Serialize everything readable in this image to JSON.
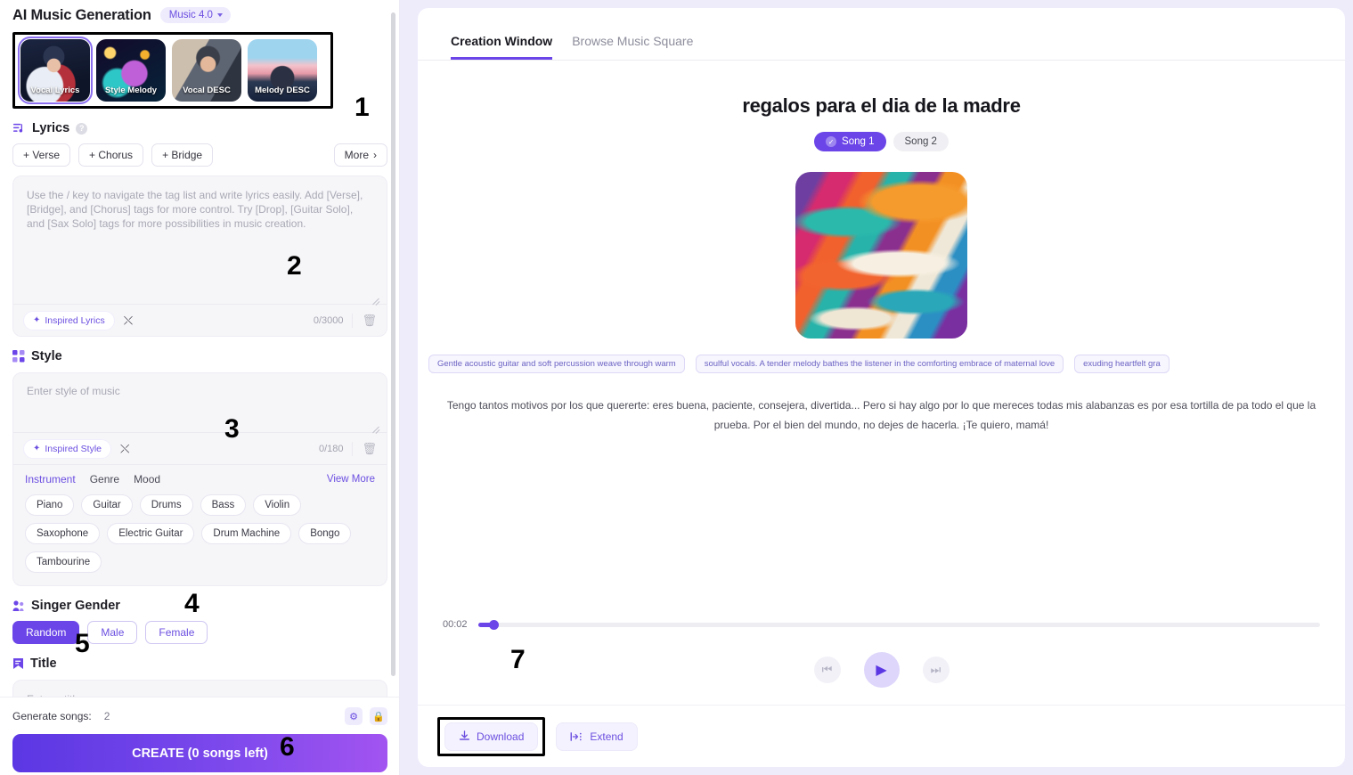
{
  "left": {
    "app_title": "AI Music Generation",
    "model_badge": "Music 4.0",
    "modes": [
      {
        "label": "Vocal Lyrics",
        "selected": true
      },
      {
        "label": "Style Melody",
        "selected": false
      },
      {
        "label": "Vocal DESC",
        "selected": false
      },
      {
        "label": "Melody DESC",
        "selected": false
      }
    ],
    "lyrics": {
      "heading": "Lyrics",
      "buttons": [
        "+ Verse",
        "+ Chorus",
        "+ Bridge"
      ],
      "more_label": "More",
      "placeholder": "Use the / key to navigate the tag list and write lyrics easily. Add [Verse], [Bridge], and [Chorus] tags for more control. Try [Drop], [Guitar Solo], and [Sax Solo] tags for more possibilities in music creation.",
      "inspire_label": "Inspired Lyrics",
      "counter": "0/3000"
    },
    "style": {
      "heading": "Style",
      "placeholder": "Enter style of music",
      "inspire_label": "Inspired Style",
      "counter": "0/180",
      "tabs": [
        "Instrument",
        "Genre",
        "Mood"
      ],
      "view_more": "View More",
      "chips": [
        "Piano",
        "Guitar",
        "Drums",
        "Bass",
        "Violin",
        "Saxophone",
        "Electric Guitar",
        "Drum Machine",
        "Bongo",
        "Tambourine"
      ]
    },
    "gender": {
      "heading": "Singer Gender",
      "options": [
        {
          "label": "Random",
          "selected": true
        },
        {
          "label": "Male",
          "selected": false
        },
        {
          "label": "Female",
          "selected": false
        }
      ]
    },
    "title": {
      "heading": "Title",
      "placeholder": "Enter a title"
    },
    "footer": {
      "generate_label": "Generate songs:",
      "generate_value": "2",
      "create_label": "CREATE (0 songs left)"
    }
  },
  "right": {
    "tabs": [
      {
        "label": "Creation Window",
        "active": true
      },
      {
        "label": "Browse Music Square",
        "active": false
      }
    ],
    "song_title": "regalos para el dia de la madre",
    "song_pills": [
      {
        "label": "Song 1",
        "selected": true
      },
      {
        "label": "Song 2",
        "selected": false
      }
    ],
    "desc_tags": [
      "Gentle acoustic guitar and soft percussion weave through warm",
      "soulful vocals. A tender melody bathes the listener in the comforting embrace of maternal love",
      "exuding heartfelt gra"
    ],
    "lyrics_text": "Tengo tantos motivos por los que quererte: eres buena, paciente, consejera, divertida... Pero si hay algo por lo que mereces todas mis alabanzas es por esa tortilla de pa todo el que la prueba. Por el bien del mundo, no dejes de hacerla. ¡Te quiero, mamá!",
    "player": {
      "current_time": "00:02"
    },
    "actions": {
      "download_label": "Download",
      "extend_label": "Extend"
    }
  },
  "annotations": {
    "n1": "1",
    "n2": "2",
    "n3": "3",
    "n4": "4",
    "n5": "5",
    "n6": "6",
    "n7": "7"
  },
  "colors": {
    "accent": "#6b45e8",
    "accent_light": "#eeebfd",
    "panel_bg": "#eeecfb"
  }
}
